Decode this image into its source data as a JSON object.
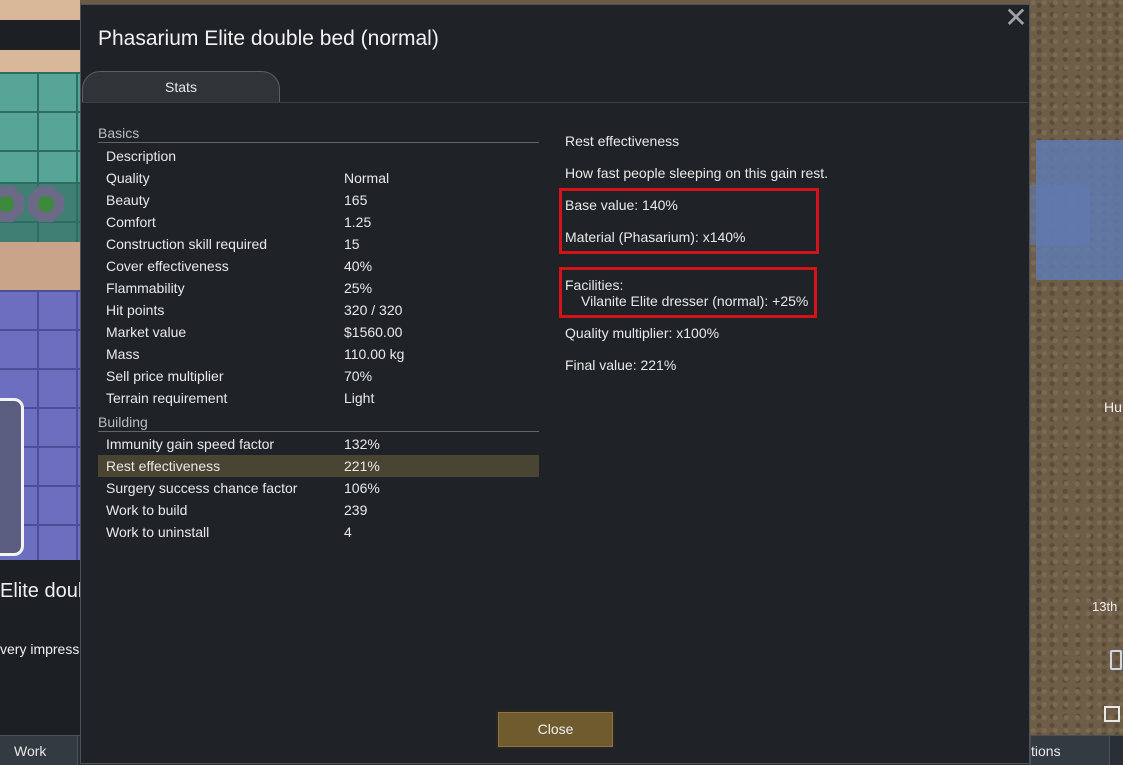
{
  "background": {
    "left_title_fragment": "Elite doubl",
    "left_desc_fragment": "very impressi",
    "right_text_hu": "Hu",
    "right_text_date": "13th"
  },
  "bottom_bar": {
    "work_label": "Work",
    "right_label": "tions"
  },
  "dialog": {
    "title": "Phasarium Elite double bed (normal)",
    "tab_label": "Stats",
    "close_button_label": "Close"
  },
  "basics": {
    "header": "Basics",
    "rows": [
      {
        "label": "Description",
        "value": ""
      },
      {
        "label": "Quality",
        "value": "Normal"
      },
      {
        "label": "Beauty",
        "value": "165"
      },
      {
        "label": "Comfort",
        "value": "1.25"
      },
      {
        "label": "Construction skill required",
        "value": "15"
      },
      {
        "label": "Cover effectiveness",
        "value": "40%"
      },
      {
        "label": "Flammability",
        "value": "25%"
      },
      {
        "label": "Hit points",
        "value": "320 / 320"
      },
      {
        "label": "Market value",
        "value": "$1560.00"
      },
      {
        "label": "Mass",
        "value": "110.00 kg"
      },
      {
        "label": "Sell price multiplier",
        "value": "70%"
      },
      {
        "label": "Terrain requirement",
        "value": "Light"
      }
    ]
  },
  "building": {
    "header": "Building",
    "rows": [
      {
        "label": "Immunity gain speed factor",
        "value": "132%"
      },
      {
        "label": "Rest effectiveness",
        "value": "221%"
      },
      {
        "label": "Surgery success chance factor",
        "value": "106%"
      },
      {
        "label": "Work to build",
        "value": "239"
      },
      {
        "label": "Work to uninstall",
        "value": "4"
      }
    ],
    "selected_index": 1
  },
  "info": {
    "title": "Rest effectiveness",
    "description": "How fast people sleeping on this gain rest.",
    "base_value": "Base value: 140%",
    "material": "Material (Phasarium): x140%",
    "facilities_header": "Facilities:",
    "facility_item": "Vilanite Elite dresser (normal): +25%",
    "quality_multiplier": "Quality multiplier: x100%",
    "final_value": "Final value: 221%"
  },
  "colors": {
    "dialog_bg": "#1f2327",
    "highlight_row": "#4a4532",
    "annotation_red": "#d4121a",
    "close_button": "#6f5b2e"
  }
}
